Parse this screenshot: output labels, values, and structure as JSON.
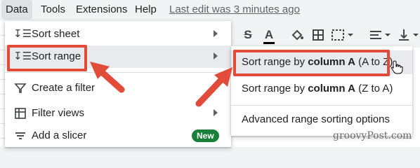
{
  "menubar": {
    "items": [
      "Data",
      "Tools",
      "Extensions",
      "Help"
    ],
    "last_edit": "Last edit was 3 minutes ago"
  },
  "toolbar": {
    "icons": [
      "strikethrough-icon",
      "text-color-icon",
      "fill-color-icon",
      "borders-icon",
      "merge-cells-icon",
      "horizontal-align-icon",
      "vertical-align-icon"
    ]
  },
  "data_menu": {
    "items": [
      {
        "label": "Sort sheet",
        "icon": "sort-icon",
        "submenu": true
      },
      {
        "label": "Sort range",
        "icon": "sort-icon",
        "submenu": true,
        "highlighted": true
      },
      {
        "label": "Create a filter",
        "icon": "filter-icon"
      },
      {
        "label": "Filter views",
        "icon": "filter-views-icon",
        "submenu": true
      },
      {
        "label": "Add a slicer",
        "icon": "slicer-icon",
        "badge": "New"
      }
    ]
  },
  "sort_submenu": {
    "items": [
      {
        "prefix": "Sort range by ",
        "bold": "column A",
        "suffix": " (A to Z)",
        "highlighted": true
      },
      {
        "prefix": "Sort range by ",
        "bold": "column A",
        "suffix": " (Z to A)"
      },
      {
        "prefix": "Advanced range sorting options",
        "bold": "",
        "suffix": ""
      }
    ]
  },
  "colors": {
    "annotation_red": "#e04b3a",
    "highlight": "#e8eaed",
    "badge_green": "#188038"
  },
  "watermark": "groovyPost.com"
}
